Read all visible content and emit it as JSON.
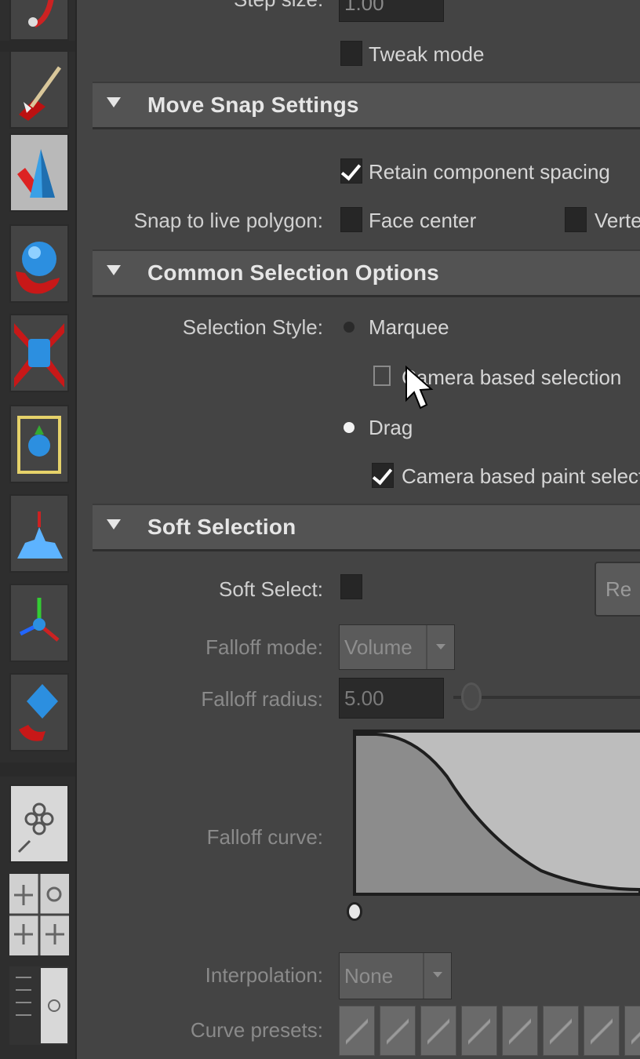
{
  "colors": {
    "panel_bg": "#444444",
    "header_bg": "#535353",
    "toolbar_bg": "#2e2e2e",
    "check_white": "#ffffff",
    "curve_light": "#bdbdbd",
    "curve_dark": "#8c8c8c"
  },
  "toolbar": {
    "tools": [
      {
        "name": "lasso-tool-icon"
      },
      {
        "name": "paint-select-tool-icon"
      },
      {
        "name": "move-tool-icon",
        "selected": true
      },
      {
        "name": "rotate-tool-icon"
      },
      {
        "name": "scale-tool-icon"
      },
      {
        "name": "universal-manipulator-icon"
      },
      {
        "name": "soft-mod-tool-icon"
      },
      {
        "name": "show-manipulator-icon"
      },
      {
        "name": "last-tool-icon"
      }
    ],
    "layout_buttons": [
      "single-view-icon",
      "four-view-layout-icon",
      "side-by-side-layout-icon"
    ]
  },
  "top_partial": {
    "step_size_label": "Step size:",
    "step_size_value": "1.00",
    "tweak_mode_label": "Tweak mode",
    "tweak_mode_checked": false
  },
  "sections": {
    "move_snap": {
      "title": "Move Snap Settings",
      "retain_spacing_label": "Retain component spacing",
      "retain_spacing_checked": true,
      "snap_live_label": "Snap to live polygon:",
      "face_center_label": "Face center",
      "face_center_checked": false,
      "vertex_label_partial": "Verte"
    },
    "common_selection": {
      "title": "Common Selection Options",
      "selection_style_label": "Selection Style:",
      "marquee_label": "Marquee",
      "camera_based_selection_label": "Camera based selection",
      "camera_based_selection_checked": false,
      "drag_label": "Drag",
      "camera_paint_label": "Camera based paint selectio",
      "camera_paint_checked": true,
      "selected_style": "Drag"
    },
    "soft_selection": {
      "title": "Soft Selection",
      "soft_select_label": "Soft Select:",
      "soft_select_checked": false,
      "reset_button_partial": "Re",
      "falloff_mode_label": "Falloff mode:",
      "falloff_mode_value": "Volume",
      "falloff_radius_label": "Falloff radius:",
      "falloff_radius_value": "5.00",
      "falloff_curve_label": "Falloff curve:",
      "interpolation_label": "Interpolation:",
      "interpolation_value": "None",
      "curve_presets_label": "Curve presets:"
    }
  }
}
